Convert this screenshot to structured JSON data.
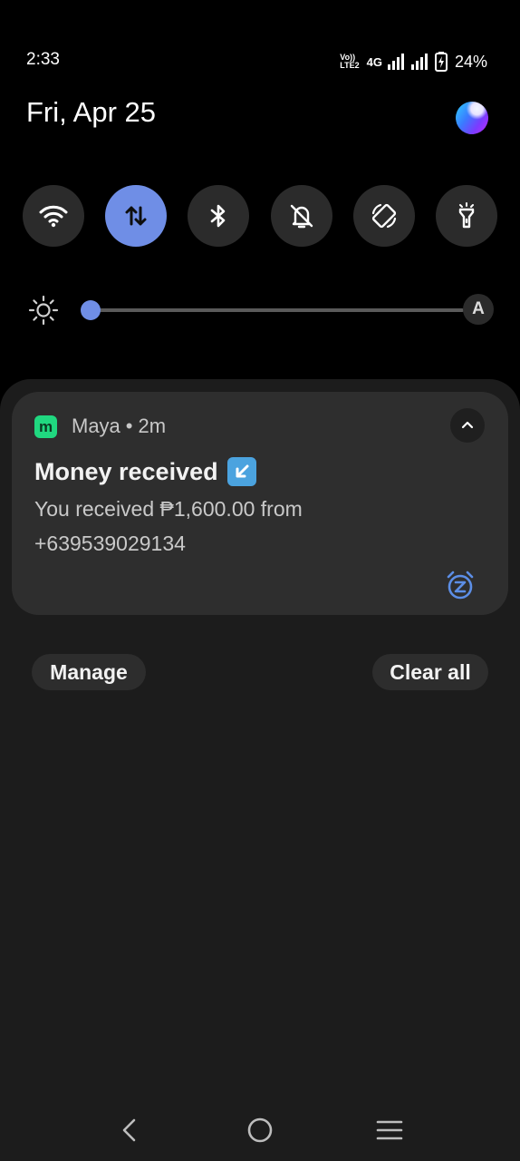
{
  "status_bar": {
    "time": "2:33",
    "volte_top": "Vo))",
    "volte_bottom": "LTE2",
    "network": "4G",
    "battery": "24%"
  },
  "header": {
    "date": "Fri, Apr 25"
  },
  "quick_settings": [
    {
      "name": "wifi-icon",
      "active": false
    },
    {
      "name": "mobile-data-icon",
      "active": true
    },
    {
      "name": "bluetooth-icon",
      "active": false
    },
    {
      "name": "mute-bell-icon",
      "active": false
    },
    {
      "name": "auto-rotate-icon",
      "active": false
    },
    {
      "name": "flashlight-icon",
      "active": false
    }
  ],
  "brightness": {
    "level": 0.02,
    "auto_label": "A"
  },
  "notification": {
    "app_icon_letter": "m",
    "app_name": "Maya",
    "separator": "•",
    "time_ago": "2m",
    "title": "Money received",
    "body": "You received ₱1,600.00 from +639539029134",
    "accent_color": "#20d880"
  },
  "actions": {
    "manage_label": "Manage",
    "clear_all_label": "Clear all"
  },
  "colors": {
    "active_tile": "#6f8ee6",
    "snooze_icon": "#5c8ee6"
  }
}
